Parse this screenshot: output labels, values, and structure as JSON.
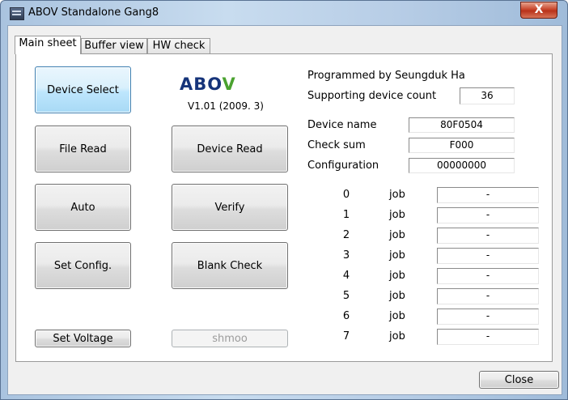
{
  "window": {
    "title": "ABOV Standalone Gang8",
    "close_glyph": "X"
  },
  "tabs": [
    {
      "label": "Main sheet",
      "active": true
    },
    {
      "label": "Buffer view",
      "active": false
    },
    {
      "label": "HW check",
      "active": false
    }
  ],
  "buttons": {
    "device_select": "Device Select",
    "file_read": "File Read",
    "device_read": "Device Read",
    "auto": "Auto",
    "verify": "Verify",
    "set_config": "Set Config.",
    "blank_check": "Blank Check",
    "set_voltage": "Set Voltage",
    "shmoo": "shmoo",
    "close": "Close"
  },
  "logo": {
    "text_main": "ABO",
    "text_accent": "V",
    "version": "V1.01 (2009. 3)"
  },
  "info": {
    "programmed_by": "Programmed by Seungduk Ha",
    "supporting_label": "Supporting device count",
    "supporting_value": "36",
    "device_name_label": "Device name",
    "device_name_value": "80F0504",
    "checksum_label": "Check sum",
    "checksum_value": "F000",
    "configuration_label": "Configuration",
    "configuration_value": "00000000"
  },
  "jobs": [
    {
      "num": "0",
      "label": "job",
      "value": "-"
    },
    {
      "num": "1",
      "label": "job",
      "value": "-"
    },
    {
      "num": "2",
      "label": "job",
      "value": "-"
    },
    {
      "num": "3",
      "label": "job",
      "value": "-"
    },
    {
      "num": "4",
      "label": "job",
      "value": "-"
    },
    {
      "num": "5",
      "label": "job",
      "value": "-"
    },
    {
      "num": "6",
      "label": "job",
      "value": "-"
    },
    {
      "num": "7",
      "label": "job",
      "value": "-"
    }
  ],
  "colors": {
    "logo_blue": "#16347a",
    "logo_green": "#4aa22f",
    "close_red": "#c8462c"
  }
}
